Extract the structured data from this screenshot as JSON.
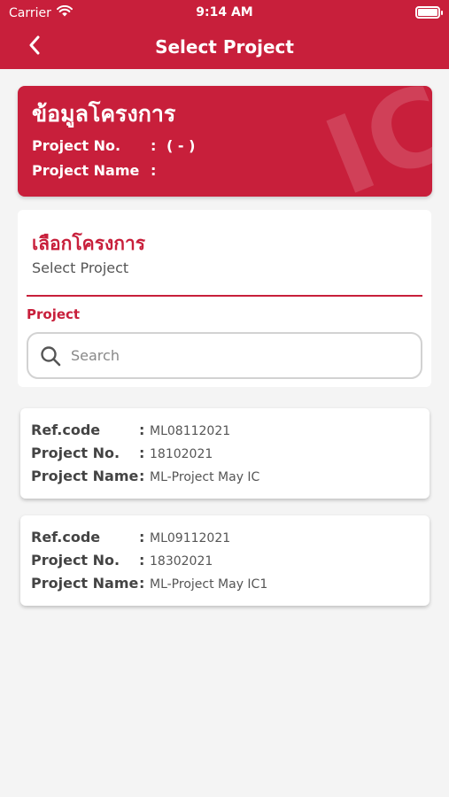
{
  "status_bar": {
    "carrier": "Carrier",
    "time": "9:14 AM"
  },
  "nav": {
    "title": "Select Project",
    "back_icon": "chevron-left-icon"
  },
  "info_card": {
    "heading": "ข้อมูลโครงการ",
    "watermark": "IC",
    "project_no_label": "Project No.",
    "project_no_value": "( - )",
    "project_name_label": "Project Name",
    "project_name_value": "",
    "colon": ":"
  },
  "select_section": {
    "heading_thai": "เลือกโครงการ",
    "heading_en": "Select Project",
    "field_label": "Project",
    "search_placeholder": "Search",
    "search_value": ""
  },
  "projects": [
    {
      "ref_label": "Ref.code",
      "ref": "ML08112021",
      "no_label": "Project No.",
      "no": "18102021",
      "name_label": "Project Name",
      "name": "ML-Project May IC",
      "colon": ":"
    },
    {
      "ref_label": "Ref.code",
      "ref": "ML09112021",
      "no_label": "Project No.",
      "no": "18302021",
      "name_label": "Project Name",
      "name": "ML-Project May IC1",
      "colon": ":"
    }
  ],
  "colors": {
    "brand": "#c81f3b",
    "background": "#f4f4f4"
  }
}
